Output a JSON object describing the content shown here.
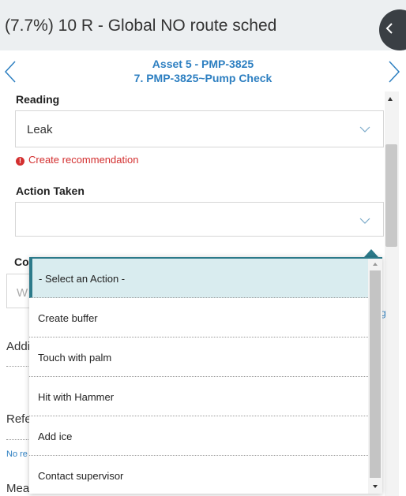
{
  "header": {
    "title": "(7.7%) 10 R - Global NO route sched"
  },
  "nav": {
    "asset": "Asset 5 - PMP-3825",
    "step": "7. PMP-3825~Pump Check"
  },
  "form": {
    "reading_label": "Reading",
    "reading_value": "Leak",
    "recommendation_link": "Create recommendation",
    "action_label": "Action Taken",
    "action_value": "",
    "comments_label_partial": "Co",
    "comments_placeholder_partial": "W",
    "link_partial": "g",
    "additional_partial": "Addi",
    "reference_partial": "Refe",
    "no_reference_partial": "No re",
    "measurement_partial": "Mea"
  },
  "dropdown": {
    "options": [
      "- Select an Action -",
      "Create buffer",
      "Touch with palm",
      "Hit with Hammer",
      "Add ice",
      "Contact supervisor"
    ],
    "selected_index": 0
  },
  "colors": {
    "accent_link": "#2d7fc1",
    "teal": "#2c7a8a",
    "error_red": "#d32f2f",
    "selected_bg": "#d9ecef"
  }
}
